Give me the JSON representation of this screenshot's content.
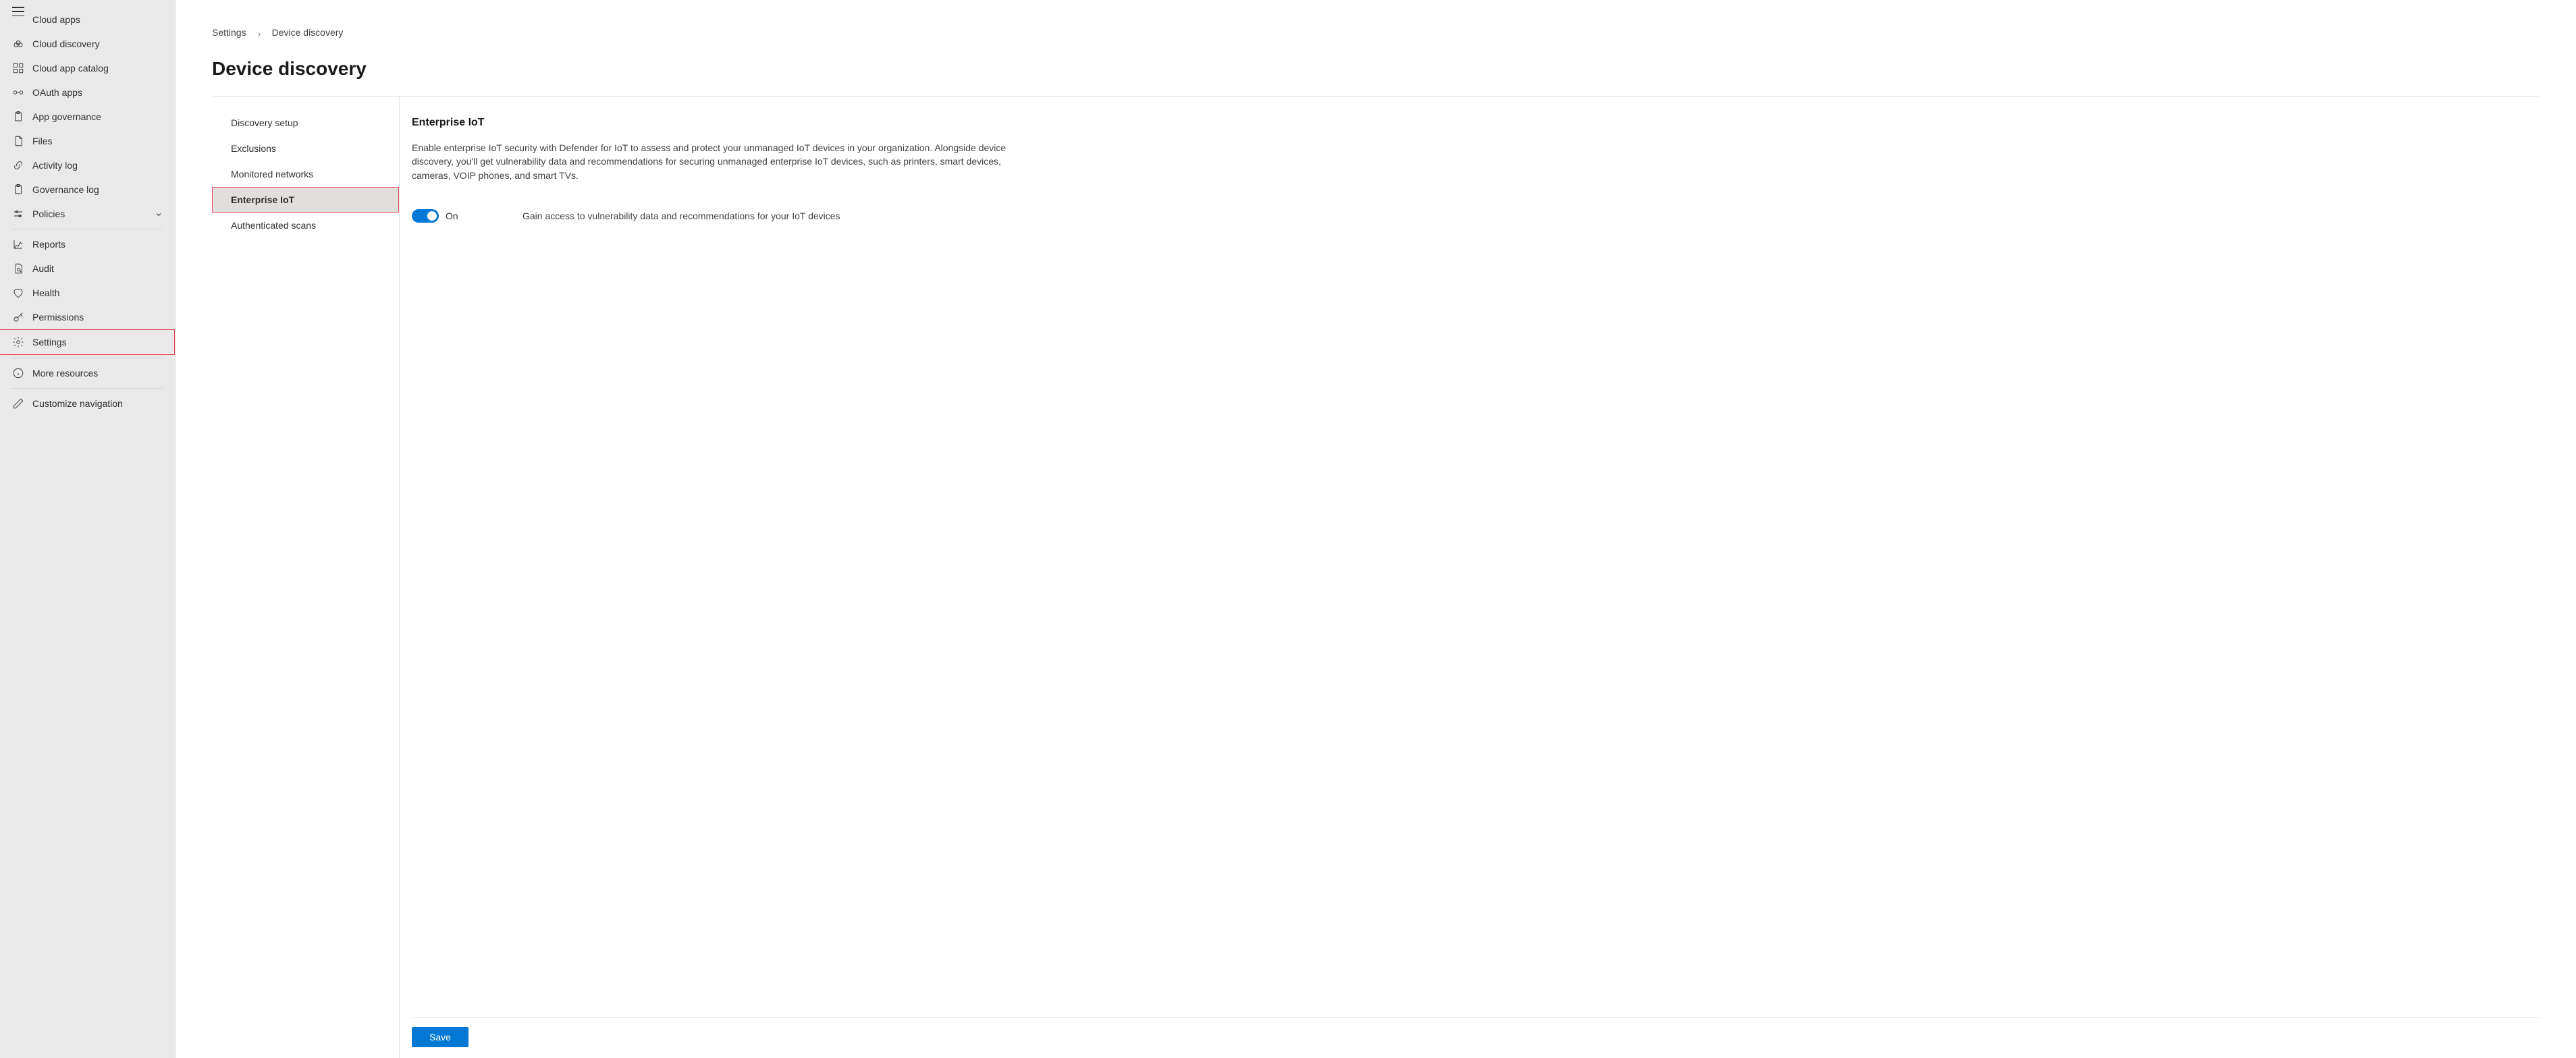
{
  "sidebar": {
    "items_partial_top": {
      "label": "Cloud apps"
    },
    "items": [
      {
        "id": "cloud-discovery",
        "label": "Cloud discovery",
        "icon": "cloud-discovery"
      },
      {
        "id": "cloud-app-catalog",
        "label": "Cloud app catalog",
        "icon": "app-catalog"
      },
      {
        "id": "oauth-apps",
        "label": "OAuth apps",
        "icon": "oauth"
      },
      {
        "id": "app-governance",
        "label": "App governance",
        "icon": "clipboard"
      },
      {
        "id": "files",
        "label": "Files",
        "icon": "file"
      },
      {
        "id": "activity-log",
        "label": "Activity log",
        "icon": "link"
      },
      {
        "id": "governance-log",
        "label": "Governance log",
        "icon": "clipboard"
      },
      {
        "id": "policies",
        "label": "Policies",
        "icon": "sliders",
        "expandable": true
      }
    ],
    "items2": [
      {
        "id": "reports",
        "label": "Reports",
        "icon": "chart"
      },
      {
        "id": "audit",
        "label": "Audit",
        "icon": "audit"
      },
      {
        "id": "health",
        "label": "Health",
        "icon": "heart"
      },
      {
        "id": "permissions",
        "label": "Permissions",
        "icon": "key"
      },
      {
        "id": "settings",
        "label": "Settings",
        "icon": "gear",
        "highlighted": true
      }
    ],
    "items3": [
      {
        "id": "more-resources",
        "label": "More resources",
        "icon": "info"
      }
    ],
    "items4": [
      {
        "id": "customize-navigation",
        "label": "Customize navigation",
        "icon": "pencil"
      }
    ]
  },
  "breadcrumb": {
    "parent": "Settings",
    "current": "Device discovery"
  },
  "page": {
    "title": "Device discovery"
  },
  "subnav": {
    "items": [
      {
        "id": "discovery-setup",
        "label": "Discovery setup"
      },
      {
        "id": "exclusions",
        "label": "Exclusions"
      },
      {
        "id": "monitored-networks",
        "label": "Monitored networks"
      },
      {
        "id": "enterprise-iot",
        "label": "Enterprise IoT",
        "active": true,
        "highlighted": true
      },
      {
        "id": "authenticated-scans",
        "label": "Authenticated scans"
      }
    ]
  },
  "detail": {
    "title": "Enterprise IoT",
    "description": "Enable enterprise IoT security with Defender for IoT to assess and protect your unmanaged IoT devices in your organization. Alongside device discovery, you'll get vulnerability data and recommendations for securing unmanaged enterprise IoT devices, such as printers, smart devices, cameras, VOIP phones, and smart TVs.",
    "toggle": {
      "state_label": "On",
      "description": "Gain access to vulnerability data and recommendations for your IoT devices"
    },
    "save_label": "Save"
  },
  "colors": {
    "accent": "#0078d4",
    "highlight": "#e74856"
  }
}
